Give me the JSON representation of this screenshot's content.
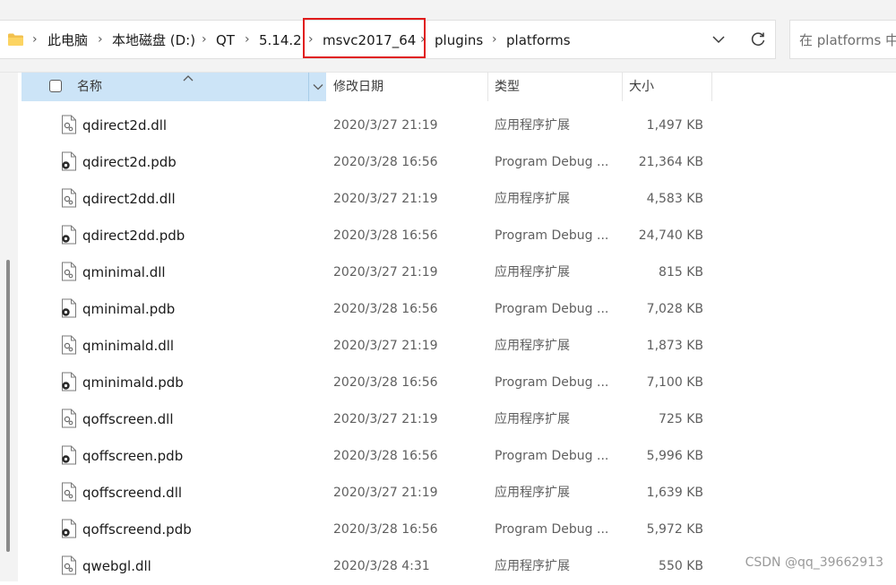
{
  "breadcrumb": [
    "此电脑",
    "本地磁盘 (D:)",
    "QT",
    "5.14.2",
    "msvc2017_64",
    "plugins",
    "platforms"
  ],
  "search": {
    "placeholder": "在 platforms 中搜索"
  },
  "columns": {
    "name": "名称",
    "date": "修改日期",
    "type": "类型",
    "size": "大小"
  },
  "files": [
    {
      "name": "qdirect2d.dll",
      "date": "2020/3/27 21:19",
      "type": "应用程序扩展",
      "size": "1,497 KB",
      "icon": "dll-file-icon"
    },
    {
      "name": "qdirect2d.pdb",
      "date": "2020/3/28 16:56",
      "type": "Program Debug ...",
      "size": "21,364 KB",
      "icon": "pdb-file-icon"
    },
    {
      "name": "qdirect2dd.dll",
      "date": "2020/3/27 21:19",
      "type": "应用程序扩展",
      "size": "4,583 KB",
      "icon": "dll-file-icon"
    },
    {
      "name": "qdirect2dd.pdb",
      "date": "2020/3/28 16:56",
      "type": "Program Debug ...",
      "size": "24,740 KB",
      "icon": "pdb-file-icon"
    },
    {
      "name": "qminimal.dll",
      "date": "2020/3/27 21:19",
      "type": "应用程序扩展",
      "size": "815 KB",
      "icon": "dll-file-icon"
    },
    {
      "name": "qminimal.pdb",
      "date": "2020/3/28 16:56",
      "type": "Program Debug ...",
      "size": "7,028 KB",
      "icon": "pdb-file-icon"
    },
    {
      "name": "qminimald.dll",
      "date": "2020/3/27 21:19",
      "type": "应用程序扩展",
      "size": "1,873 KB",
      "icon": "dll-file-icon"
    },
    {
      "name": "qminimald.pdb",
      "date": "2020/3/28 16:56",
      "type": "Program Debug ...",
      "size": "7,100 KB",
      "icon": "pdb-file-icon"
    },
    {
      "name": "qoffscreen.dll",
      "date": "2020/3/27 21:19",
      "type": "应用程序扩展",
      "size": "725 KB",
      "icon": "dll-file-icon"
    },
    {
      "name": "qoffscreen.pdb",
      "date": "2020/3/28 16:56",
      "type": "Program Debug ...",
      "size": "5,996 KB",
      "icon": "pdb-file-icon"
    },
    {
      "name": "qoffscreend.dll",
      "date": "2020/3/27 21:19",
      "type": "应用程序扩展",
      "size": "1,639 KB",
      "icon": "dll-file-icon"
    },
    {
      "name": "qoffscreend.pdb",
      "date": "2020/3/28 16:56",
      "type": "Program Debug ...",
      "size": "5,972 KB",
      "icon": "pdb-file-icon"
    },
    {
      "name": "qwebgl.dll",
      "date": "2020/3/28 4:31",
      "type": "应用程序扩展",
      "size": "550 KB",
      "icon": "dll-file-icon"
    }
  ],
  "watermark": "CSDN @qq_39662913",
  "colors": {
    "highlight_box": "#e01b1b",
    "header_selected": "#cce4f7"
  }
}
